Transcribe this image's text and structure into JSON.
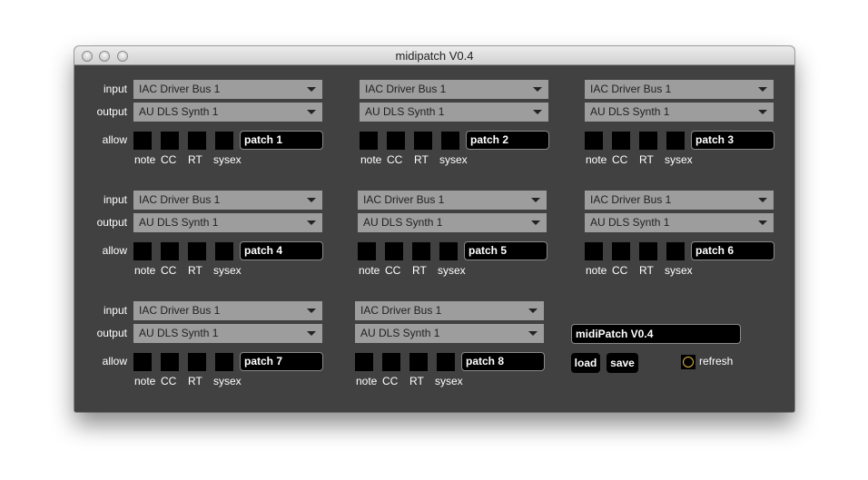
{
  "window": {
    "title": "midipatch V0.4"
  },
  "labels": {
    "input": "input",
    "output": "output",
    "allow": "allow"
  },
  "filters": [
    "note",
    "CC",
    "RT",
    "sysex"
  ],
  "patches": [
    {
      "input": "IAC Driver Bus 1",
      "output": "AU DLS Synth 1",
      "name": "patch 1"
    },
    {
      "input": "IAC Driver Bus 1",
      "output": "AU DLS Synth 1",
      "name": "patch 2"
    },
    {
      "input": "IAC Driver Bus 1",
      "output": "AU DLS Synth 1",
      "name": "patch 3"
    },
    {
      "input": "IAC Driver Bus 1",
      "output": "AU DLS Synth 1",
      "name": "patch 4"
    },
    {
      "input": "IAC Driver Bus 1",
      "output": "AU DLS Synth 1",
      "name": "patch 5"
    },
    {
      "input": "IAC Driver Bus 1",
      "output": "AU DLS Synth 1",
      "name": "patch 6"
    },
    {
      "input": "IAC Driver Bus 1",
      "output": "AU DLS Synth 1",
      "name": "patch 7"
    },
    {
      "input": "IAC Driver Bus 1",
      "output": "AU DLS Synth 1",
      "name": "patch 8"
    }
  ],
  "controls": {
    "preset_name": "midiPatch V0.4",
    "load_label": "load",
    "save_label": "save",
    "refresh_label": "refresh"
  }
}
